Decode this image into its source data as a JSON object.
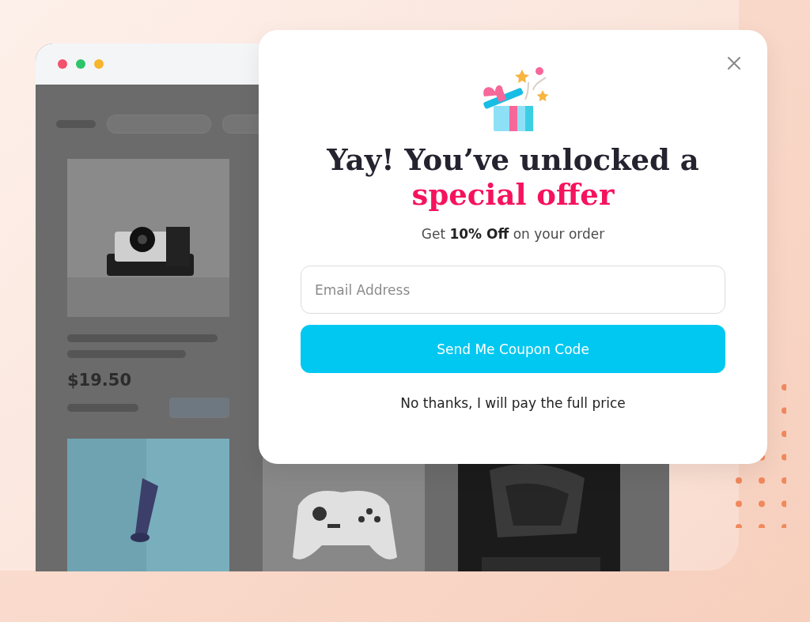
{
  "browser": {
    "listing": {
      "price": "$19.50"
    }
  },
  "popup": {
    "heading": [
      {
        "text": "Yay! You’ve unlocked a",
        "highlight": false
      },
      {
        "text": "special offer",
        "highlight": true
      }
    ],
    "subtitle": "Get **10% Off** on your order",
    "email": {
      "placeholder": "Email Address"
    },
    "submit": "Send Me Coupon Code",
    "decline": "No thanks, I will pay the full price"
  }
}
